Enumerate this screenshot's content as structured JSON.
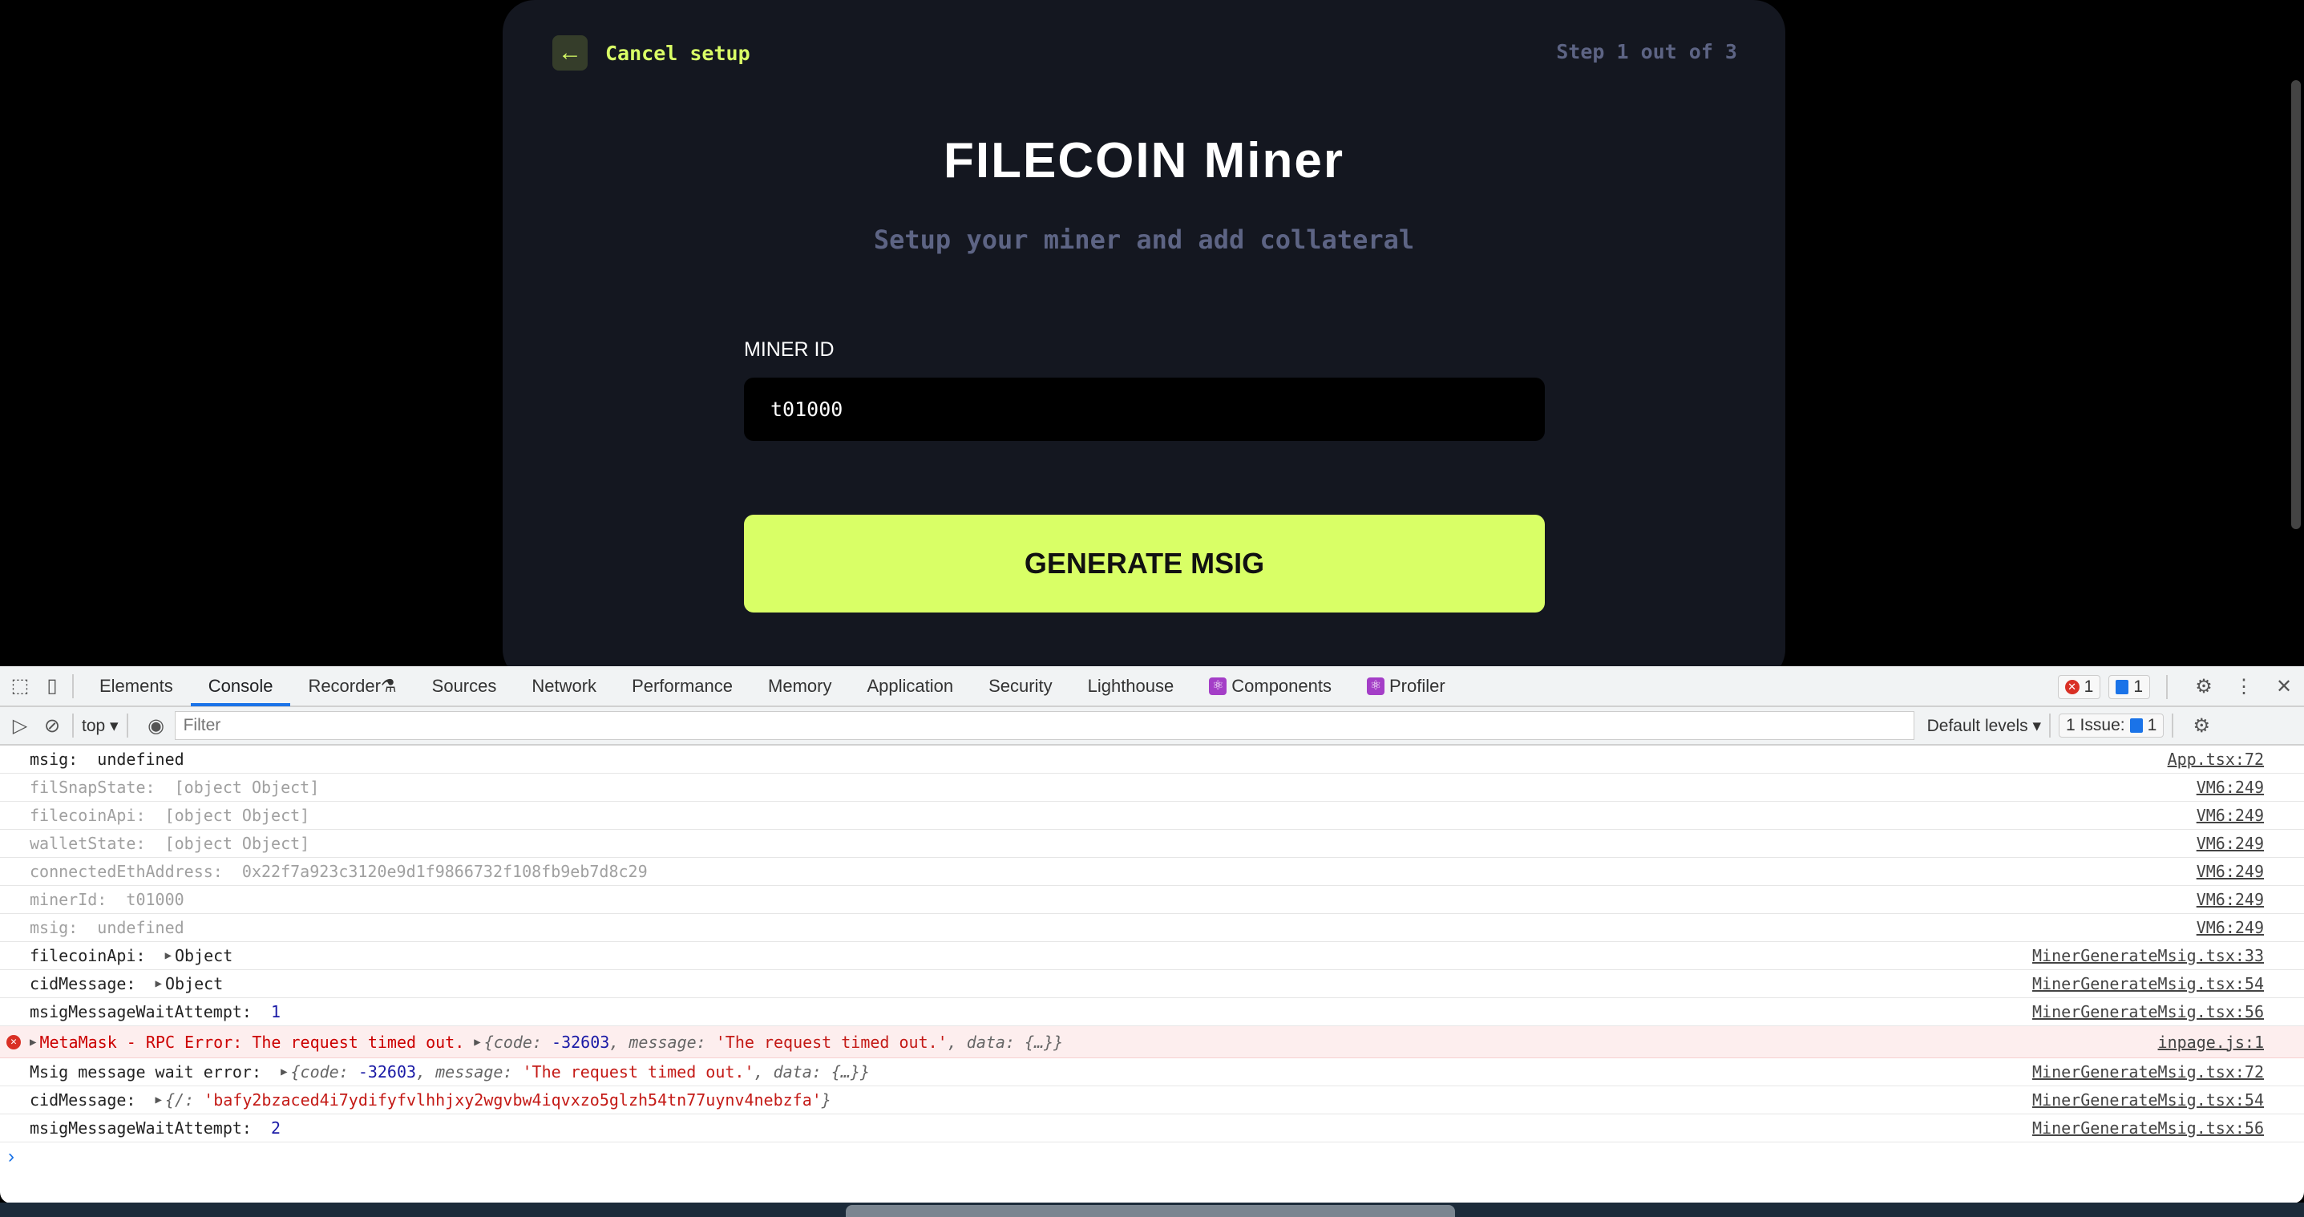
{
  "app": {
    "cancel_label": "Cancel setup",
    "step": "Step 1 out of 3",
    "title": "FILECOIN Miner",
    "subtitle": "Setup your miner and add collateral",
    "miner_id_label": "MINER ID",
    "miner_id_value": "t01000",
    "generate_label": "GENERATE MSIG",
    "accent": "#d9ff66"
  },
  "devtools": {
    "tabs": [
      "Elements",
      "Console",
      "Recorder",
      "Sources",
      "Network",
      "Performance",
      "Memory",
      "Application",
      "Security",
      "Lighthouse",
      "Components",
      "Profiler"
    ],
    "active_tab": "Console",
    "error_count": "1",
    "message_count": "1",
    "context": "top",
    "filter_placeholder": "Filter",
    "levels": "Default levels",
    "issues_label": "1 Issue:",
    "issues_count": "1",
    "rows": [
      {
        "style": "normal",
        "segs": [
          [
            "msig:  ",
            ""
          ],
          [
            "undefined",
            "it0"
          ]
        ],
        "src": "App.tsx:72"
      },
      {
        "style": "dim",
        "segs": [
          [
            "filSnapState:  [object Object]",
            ""
          ]
        ],
        "src": "VM6:249"
      },
      {
        "style": "dim",
        "segs": [
          [
            "filecoinApi:  [object Object]",
            ""
          ]
        ],
        "src": "VM6:249"
      },
      {
        "style": "dim",
        "segs": [
          [
            "walletState:  [object Object]",
            ""
          ]
        ],
        "src": "VM6:249"
      },
      {
        "style": "dim",
        "segs": [
          [
            "connectedEthAddress:  0x22f7a923c3120e9d1f9866732f108fb9eb7d8c29",
            ""
          ]
        ],
        "src": "VM6:249"
      },
      {
        "style": "dim",
        "segs": [
          [
            "minerId:  t01000",
            ""
          ]
        ],
        "src": "VM6:249"
      },
      {
        "style": "dim",
        "segs": [
          [
            "msig:  undefined",
            ""
          ]
        ],
        "src": "VM6:249"
      },
      {
        "style": "normal",
        "segs": [
          [
            "filecoinApi:  ",
            ""
          ],
          [
            "▶",
            "tri"
          ],
          [
            "Object",
            ""
          ]
        ],
        "src": "MinerGenerateMsig.tsx:33"
      },
      {
        "style": "normal",
        "segs": [
          [
            "cidMessage:  ",
            ""
          ],
          [
            "▶",
            "tri"
          ],
          [
            "Object",
            ""
          ]
        ],
        "src": "MinerGenerateMsig.tsx:54"
      },
      {
        "style": "normal",
        "segs": [
          [
            "msigMessageWaitAttempt:  ",
            ""
          ],
          [
            "1",
            "num"
          ]
        ],
        "src": "MinerGenerateMsig.tsx:56"
      },
      {
        "style": "err",
        "segs": [
          [
            "▶",
            "tri"
          ],
          [
            "MetaMask - RPC Error: The request timed out. ",
            ""
          ],
          [
            "▶",
            "tri"
          ],
          [
            "{code: ",
            "key"
          ],
          [
            "-32603",
            "num"
          ],
          [
            ", message: ",
            "key"
          ],
          [
            "'The request timed out.'",
            "str"
          ],
          [
            ", data: {…}}",
            "key"
          ]
        ],
        "src": "inpage.js:1"
      },
      {
        "style": "normal",
        "segs": [
          [
            "Msig message wait error:  ",
            ""
          ],
          [
            "▶",
            "tri"
          ],
          [
            "{code: ",
            "key"
          ],
          [
            "-32603",
            "num"
          ],
          [
            ", message: ",
            "key"
          ],
          [
            "'The request timed out.'",
            "str"
          ],
          [
            ", data: {…}}",
            "key"
          ]
        ],
        "src": "MinerGenerateMsig.tsx:72"
      },
      {
        "style": "normal",
        "segs": [
          [
            "cidMessage:  ",
            ""
          ],
          [
            "▶",
            "tri"
          ],
          [
            "{/: ",
            "key"
          ],
          [
            "'bafy2bzaced4i7ydifyfvlhhjxy2wgvbw4iqvxzo5glzh54tn77uynv4nebzfa'",
            "str"
          ],
          [
            "}",
            "key"
          ]
        ],
        "src": "MinerGenerateMsig.tsx:54"
      },
      {
        "style": "normal",
        "segs": [
          [
            "msigMessageWaitAttempt:  ",
            ""
          ],
          [
            "2",
            "num"
          ]
        ],
        "src": "MinerGenerateMsig.tsx:56"
      }
    ],
    "prompt": "›"
  }
}
